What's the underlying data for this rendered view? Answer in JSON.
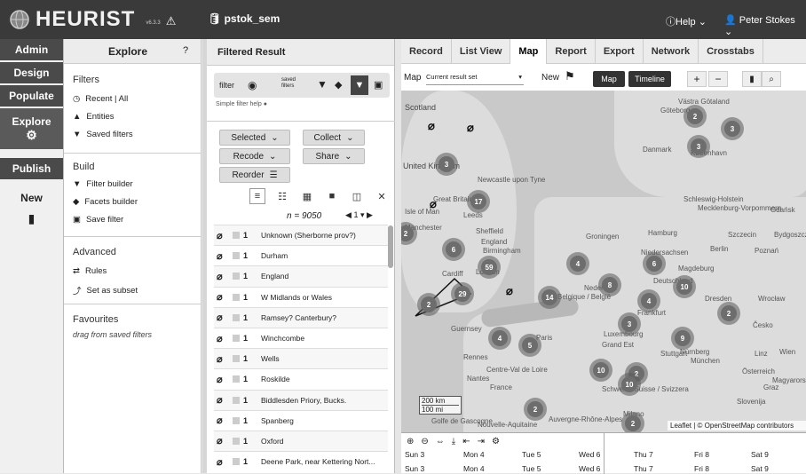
{
  "app": {
    "name": "HEURIST",
    "version": "v6.3.3",
    "database": "pstok_sem"
  },
  "top_right": {
    "help_label": "Help",
    "user_label": "Peter Stokes"
  },
  "nav": {
    "items": [
      {
        "label": "Admin"
      },
      {
        "label": "Design"
      },
      {
        "label": "Populate"
      },
      {
        "label": "Explore"
      },
      {
        "label": "Publish"
      }
    ],
    "sub_label": "New"
  },
  "explore_panel": {
    "title": "Explore",
    "filters_heading": "Filters",
    "filters_items": [
      "Recent | All",
      "Entities",
      "Saved filters"
    ],
    "build_heading": "Build",
    "build_items": [
      "Filter builder",
      "Facets builder",
      "Save filter"
    ],
    "advanced_heading": "Advanced",
    "advanced_items": [
      "Rules",
      "Set as subset"
    ],
    "favourites_heading": "Favourites",
    "favourites_sub": "drag from saved filters"
  },
  "filtered_result": {
    "title": "Filtered Result",
    "filter_label": "filter",
    "saved_filters_label": "saved filters",
    "simple_help": "Simple filter help",
    "buttons": {
      "selected": "Selected",
      "collect": "Collect",
      "recode": "Recode",
      "share": "Share",
      "reorder": "Reorder"
    },
    "count_text": "n = 9050",
    "rows": [
      {
        "num": "1",
        "title": "Unknown (Sherborne prov?)"
      },
      {
        "num": "1",
        "title": "Durham"
      },
      {
        "num": "1",
        "title": "England"
      },
      {
        "num": "1",
        "title": "W Midlands or Wales"
      },
      {
        "num": "1",
        "title": "Ramsey? Canterbury?"
      },
      {
        "num": "1",
        "title": "Winchcombe"
      },
      {
        "num": "1",
        "title": "Wells"
      },
      {
        "num": "1",
        "title": "Roskilde"
      },
      {
        "num": "1",
        "title": "Biddlesden Priory, Bucks."
      },
      {
        "num": "1",
        "title": "Spanberg"
      },
      {
        "num": "1",
        "title": "Oxford"
      },
      {
        "num": "1",
        "title": "Deene Park, near Kettering Nort..."
      }
    ]
  },
  "tabs": [
    "Record",
    "List View",
    "Map",
    "Report",
    "Export",
    "Network",
    "Crosstabs"
  ],
  "map_toolbar": {
    "map_label": "Map",
    "dataset": "Current result set",
    "new_label": "New",
    "map_button": "Map",
    "timeline_button": "Timeline"
  },
  "map": {
    "clusters": [
      "2",
      "3",
      "3",
      "3",
      "17",
      "2",
      "6",
      "59",
      "29",
      "2",
      "4",
      "14",
      "8",
      "6",
      "10",
      "4",
      "3",
      "2",
      "4",
      "5",
      "9",
      "10",
      "2",
      "10",
      "2",
      "2"
    ],
    "places": [
      "Scotland",
      "United Kingdom",
      "Newcastle upon Tyne",
      "Great Britain",
      "Isle of Man",
      "Leeds",
      "Manchester",
      "Sheffield",
      "England",
      "Birmingham",
      "Cardiff",
      "London",
      "Guernsey",
      "Rennes",
      "Nantes",
      "France",
      "Centre-Val de Loire",
      "Golfe de Gascogne",
      "Nouvelle-Aquitaine",
      "Auvergne-Rhône-Alpes",
      "Paris",
      "Belgique / België",
      "Luxembourg",
      "Grand Est",
      "Danmark",
      "København",
      "Schleswig-Holstein",
      "Mecklenburg-Vorpommern",
      "Hamburg",
      "Szczecin",
      "Bydgoszcz",
      "Poznań",
      "Gdańsk",
      "Berlin",
      "Groningen",
      "Niedersachsen",
      "Magdeburg",
      "Deutschland",
      "Dresden",
      "Wrocław",
      "Nürnberg",
      "Stuttgart",
      "München",
      "Česko",
      "Linz",
      "Wien",
      "Österreich",
      "Graz",
      "Magyarország",
      "Slovenija",
      "Schweiz / Suisse / Svizzera",
      "Milano",
      "Nederland",
      "Frankfurt",
      "Göteborg",
      "Västra Götaland"
    ],
    "scale_km": "200 km",
    "scale_mi": "100 mi",
    "attribution": "Leaflet | © OpenStreetMap contributors"
  },
  "timeline": {
    "row1": [
      "Sun 3",
      "Mon 4",
      "Tue 5",
      "Wed 6",
      "Thu 7",
      "Fri 8",
      "Sat 9"
    ],
    "row2": [
      "Sun 3",
      "Mon 4",
      "Tue 5",
      "Wed 6",
      "Thu 7",
      "Fri 8",
      "Sat 9"
    ]
  }
}
